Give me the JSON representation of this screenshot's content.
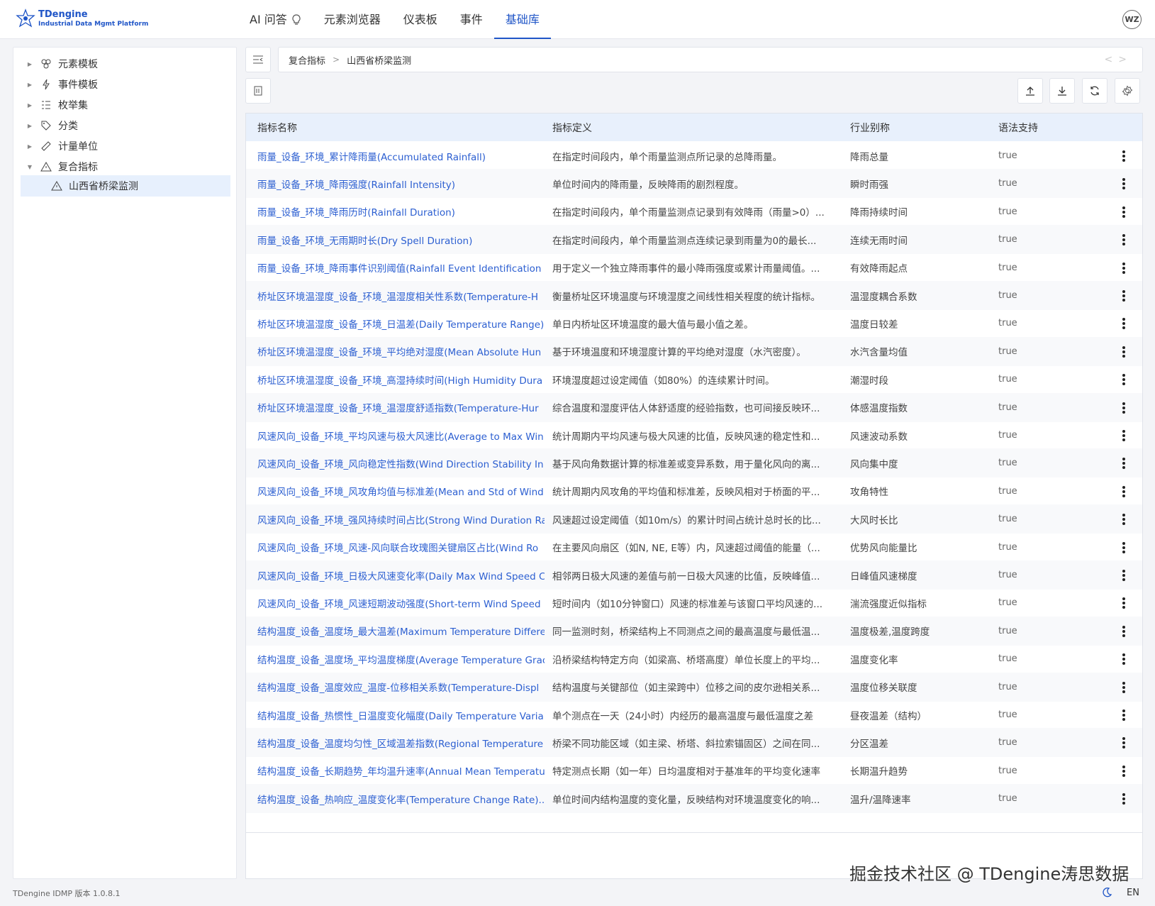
{
  "app": {
    "logo_title": "TDengine",
    "logo_subtitle": "Industrial Data Mgmt Platform",
    "avatar": "WZ",
    "version": "TDengine IDMP 版本 1.0.8.1",
    "language": "EN",
    "watermark": "掘金技术社区 @ TDengine涛思数据"
  },
  "nav": [
    {
      "label": "AI 问答"
    },
    {
      "label": "元素浏览器"
    },
    {
      "label": "仪表板"
    },
    {
      "label": "事件"
    },
    {
      "label": "基础库",
      "active": true
    }
  ],
  "sidebar": {
    "items": [
      {
        "label": "元素模板",
        "icon": "element-template-icon"
      },
      {
        "label": "事件模板",
        "icon": "lightning-icon"
      },
      {
        "label": "枚举集",
        "icon": "list-icon"
      },
      {
        "label": "分类",
        "icon": "tag-icon"
      },
      {
        "label": "计量单位",
        "icon": "ruler-icon"
      },
      {
        "label": "复合指标",
        "icon": "triangle-icon",
        "expanded": true
      }
    ],
    "child": {
      "label": "山西省桥梁监测",
      "icon": "triangle-icon"
    }
  },
  "breadcrumb": [
    "复合指标",
    "山西省桥梁监测"
  ],
  "table": {
    "headers": [
      "指标名称",
      "指标定义",
      "行业别称",
      "语法支持"
    ],
    "rows": [
      [
        "雨量_设备_环境_累计降雨量(Accumulated Rainfall)",
        "在指定时间段内，单个雨量监测点所记录的总降雨量。",
        "降雨总量",
        "true"
      ],
      [
        "雨量_设备_环境_降雨强度(Rainfall Intensity)",
        "单位时间内的降雨量，反映降雨的剧烈程度。",
        "瞬时雨强",
        "true"
      ],
      [
        "雨量_设备_环境_降雨历时(Rainfall Duration)",
        "在指定时间段内，单个雨量监测点记录到有效降雨（雨量>0）...",
        "降雨持续时间",
        "true"
      ],
      [
        "雨量_设备_环境_无雨期时长(Dry Spell Duration)",
        "在指定时间段内，单个雨量监测点连续记录到雨量为0的最长...",
        "连续无雨时间",
        "true"
      ],
      [
        "雨量_设备_环境_降雨事件识别阈值(Rainfall Event Identification",
        "用于定义一个独立降雨事件的最小降雨强度或累计雨量阈值。...",
        "有效降雨起点",
        "true"
      ],
      [
        "桥址区环境温湿度_设备_环境_温湿度相关性系数(Temperature-H",
        "衡量桥址区环境温度与环境湿度之间线性相关程度的统计指标。",
        "温湿度耦合系数",
        "true"
      ],
      [
        "桥址区环境温湿度_设备_环境_日温差(Daily Temperature Range)",
        "单日内桥址区环境温度的最大值与最小值之差。",
        "温度日较差",
        "true"
      ],
      [
        "桥址区环境温湿度_设备_环境_平均绝对湿度(Mean Absolute Hun",
        "基于环境温度和环境湿度计算的平均绝对湿度（水汽密度）。",
        "水汽含量均值",
        "true"
      ],
      [
        "桥址区环境温湿度_设备_环境_高湿持续时间(High Humidity Dura",
        "环境湿度超过设定阈值（如80%）的连续累计时间。",
        "潮湿时段",
        "true"
      ],
      [
        "桥址区环境温湿度_设备_环境_温湿度舒适指数(Temperature-Hur",
        "综合温度和湿度评估人体舒适度的经验指数，也可间接反映环...",
        "体感温度指数",
        "true"
      ],
      [
        "风速风向_设备_环境_平均风速与极大风速比(Average to Max Win",
        "统计周期内平均风速与极大风速的比值，反映风速的稳定性和...",
        "风速波动系数",
        "true"
      ],
      [
        "风速风向_设备_环境_风向稳定性指数(Wind Direction Stability In",
        "基于风向角数据计算的标准差或变异系数，用于量化风向的离...",
        "风向集中度",
        "true"
      ],
      [
        "风速风向_设备_环境_风攻角均值与标准差(Mean and Std of Wind",
        "统计周期内风攻角的平均值和标准差，反映风相对于桥面的平...",
        "攻角特性",
        "true"
      ],
      [
        "风速风向_设备_环境_强风持续时间占比(Strong Wind Duration Ra",
        "风速超过设定阈值（如10m/s）的累计时间占统计总时长的比...",
        "大风时长比",
        "true"
      ],
      [
        "风速风向_设备_环境_风速-风向联合玫瑰图关键扇区占比(Wind Ro",
        "在主要风向扇区（如N, NE, E等）内，风速超过阈值的能量（...",
        "优势风向能量比",
        "true"
      ],
      [
        "风速风向_设备_环境_日极大风速变化率(Daily Max Wind Speed C",
        "相邻两日极大风速的差值与前一日极大风速的比值，反映峰值...",
        "日峰值风速梯度",
        "true"
      ],
      [
        "风速风向_设备_环境_风速短期波动强度(Short-term Wind Speed",
        "短时间内（如10分钟窗口）风速的标准差与该窗口平均风速的...",
        "湍流强度近似指标",
        "true"
      ],
      [
        "结构温度_设备_温度场_最大温差(Maximum Temperature Differe",
        "同一监测时刻，桥梁结构上不同测点之间的最高温度与最低温...",
        "温度极差,温度跨度",
        "true"
      ],
      [
        "结构温度_设备_温度场_平均温度梯度(Average Temperature Grac",
        "沿桥梁结构特定方向（如梁高、桥塔高度）单位长度上的平均...",
        "温度变化率",
        "true"
      ],
      [
        "结构温度_设备_温度效应_温度-位移相关系数(Temperature-Displ",
        "结构温度与关键部位（如主梁跨中）位移之间的皮尔逊相关系...",
        "温度位移关联度",
        "true"
      ],
      [
        "结构温度_设备_热惯性_日温度变化幅度(Daily Temperature Varia",
        "单个测点在一天（24小时）内经历的最高温度与最低温度之差",
        "昼夜温差（结构）",
        "true"
      ],
      [
        "结构温度_设备_温度均匀性_区域温差指数(Regional Temperature",
        "桥梁不同功能区域（如主梁、桥塔、斜拉索锚固区）之间在同...",
        "分区温差",
        "true"
      ],
      [
        "结构温度_设备_长期趋势_年均温升速率(Annual Mean Temperatu",
        "特定测点长期（如一年）日均温度相对于基准年的平均变化速率",
        "长期温升趋势",
        "true"
      ],
      [
        "结构温度_设备_热响应_温度变化率(Temperature Change Rate)...",
        "单位时间内结构温度的变化量，反映结构对环境温度变化的响...",
        "温升/温降速率",
        "true"
      ]
    ]
  }
}
